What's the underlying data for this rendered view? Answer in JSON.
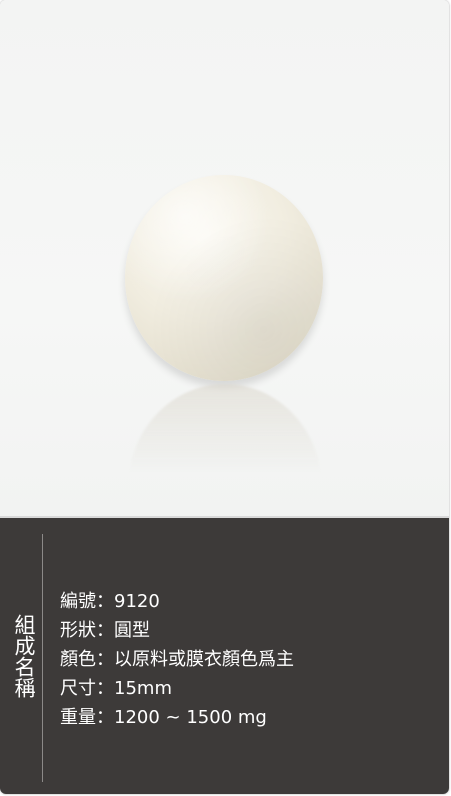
{
  "product": {
    "photo_alt": "round white tablet",
    "section_title": "組成名稱",
    "specs": [
      {
        "label": "編號",
        "sep": "：",
        "value": "9120"
      },
      {
        "label": "形狀",
        "sep": "：",
        "value": "圓型"
      },
      {
        "label": "顏色",
        "sep": "：",
        "value": "以原料或膜衣顏色爲主"
      },
      {
        "label": "尺寸",
        "sep": "：",
        "value": "15mm"
      },
      {
        "label": "重量",
        "sep": "：",
        "value": "1200 ~ 1500 mg"
      }
    ]
  },
  "colors": {
    "panel_bg": "#3d3a39",
    "photo_bg": "#f5f6f5",
    "tablet": "#efebde",
    "text": "#ffffff"
  }
}
